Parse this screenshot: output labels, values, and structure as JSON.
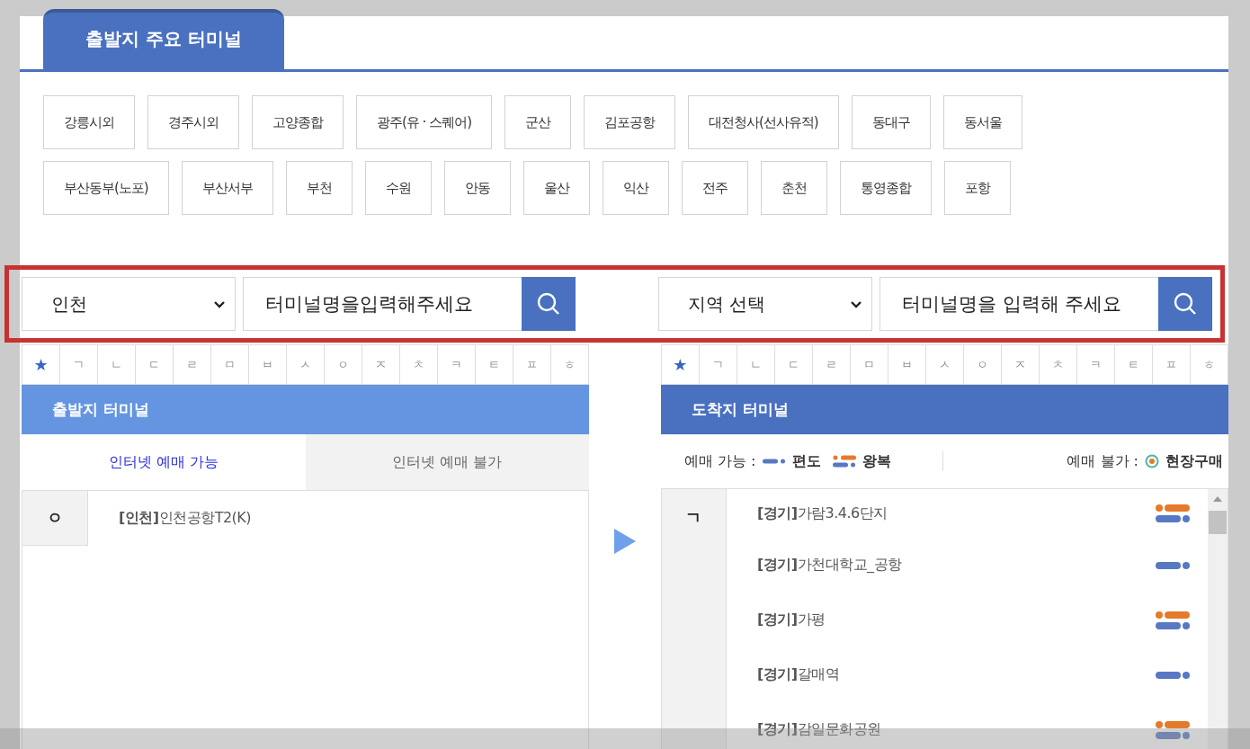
{
  "tab": {
    "label": "출발지 주요 터미널",
    "selected": true
  },
  "terminal_rows": [
    [
      "강릉시외",
      "경주시외",
      "고양종합",
      "광주(유 · 스퀘어)",
      "군산",
      "김포공항",
      "대전청사(선사유적)",
      "동대구",
      "동서울"
    ],
    [
      "부산동부(노포)",
      "부산서부",
      "부천",
      "수원",
      "안동",
      "울산",
      "익산",
      "전주",
      "춘천",
      "통영종합",
      "포항"
    ]
  ],
  "departure_search": {
    "region": "인천",
    "value": "터미널명을입력해주세요"
  },
  "arrival_search": {
    "region": "지역 선택",
    "value": "터미널명을 입력해 주세요"
  },
  "departure_index": [
    {
      "label": "★",
      "selected": true
    },
    {
      "label": "ㄱ",
      "selected": false
    },
    {
      "label": "ㄴ",
      "selected": false
    },
    {
      "label": "ㄷ",
      "selected": false
    },
    {
      "label": "ㄹ",
      "selected": false
    },
    {
      "label": "ㅁ",
      "selected": false
    },
    {
      "label": "ㅂ",
      "selected": false
    },
    {
      "label": "ㅅ",
      "selected": false
    },
    {
      "label": "ㅇ",
      "selected": false
    },
    {
      "label": "ㅈ",
      "selected": false
    },
    {
      "label": "ㅊ",
      "selected": false
    },
    {
      "label": "ㅋ",
      "selected": false
    },
    {
      "label": "ㅌ",
      "selected": false
    },
    {
      "label": "ㅍ",
      "selected": false
    },
    {
      "label": "ㅎ",
      "selected": false
    }
  ],
  "arrival_index": [
    {
      "label": "★",
      "selected": true
    },
    {
      "label": "ㄱ",
      "selected": false
    },
    {
      "label": "ㄴ",
      "selected": false
    },
    {
      "label": "ㄷ",
      "selected": false
    },
    {
      "label": "ㄹ",
      "selected": false
    },
    {
      "label": "ㅁ",
      "selected": false
    },
    {
      "label": "ㅂ",
      "selected": false
    },
    {
      "label": "ㅅ",
      "selected": false
    },
    {
      "label": "ㅇ",
      "selected": false
    },
    {
      "label": "ㅈ",
      "selected": false
    },
    {
      "label": "ㅊ",
      "selected": false
    },
    {
      "label": "ㅋ",
      "selected": false
    },
    {
      "label": "ㅌ",
      "selected": false
    },
    {
      "label": "ㅍ",
      "selected": false
    },
    {
      "label": "ㅎ",
      "selected": false
    }
  ],
  "departure": {
    "title": "출발지 터미널",
    "subtabs": [
      {
        "label": "인터넷 예매 가능",
        "selected": true
      },
      {
        "label": "인터넷 예매 불가",
        "selected": false
      }
    ],
    "groups": [
      {
        "initial": "ㅇ",
        "items": [
          "**[인천]**인천공항T2(K)"
        ]
      }
    ]
  },
  "arrival": {
    "title": "도착지 터미널",
    "legend": {
      "available_label": "예매 가능 :",
      "available": [
        {
          "kind": "oneway",
          "label": "편도"
        },
        {
          "kind": "roundtrip",
          "label": "왕복"
        }
      ],
      "unavailable_label": "예매 불가 :",
      "unavailable": [
        {
          "kind": "onsite",
          "label": "현장구매"
        }
      ]
    },
    "groups": [
      {
        "initial": "ㄱ",
        "items": [
          {
            "name": "**[경기]**가람3.4.6단지",
            "kind": "roundtrip"
          },
          {
            "name": "**[경기]**가천대학교_공항",
            "kind": "oneway"
          },
          {
            "name": "**[경기]**가평",
            "kind": "roundtrip"
          },
          {
            "name": "**[경기]**갈매역",
            "kind": "oneway"
          },
          {
            "name": "**[경기]**감일문화공원",
            "kind": "roundtrip"
          }
        ]
      }
    ]
  }
}
